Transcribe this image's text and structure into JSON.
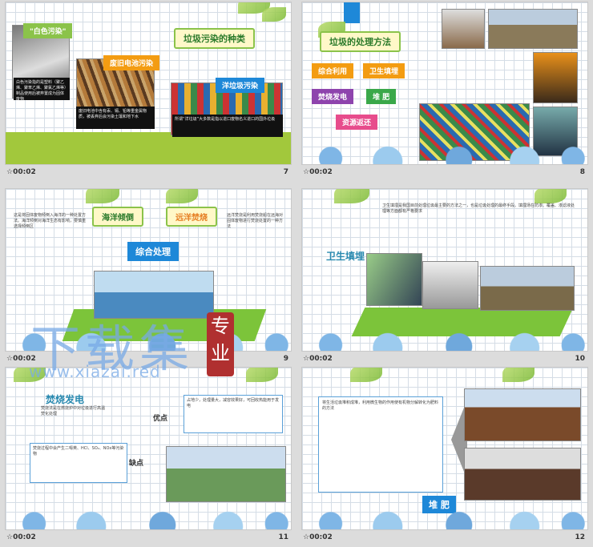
{
  "slides": [
    {
      "time": "00:02",
      "num": "7",
      "title": "垃圾污染的种类",
      "labels": {
        "white": "\"白色污染\"",
        "battery": "废旧电池污染",
        "ocean": "洋垃圾污染"
      },
      "texts": {
        "white": "白色污染指的是塑料（聚乙烯、聚苯乙烯、聚氯乙烯等）制品使用后被弃置成为固体废物",
        "battery": "废旧电池中含有汞、镉、铅等重金属物质，被丢弃后会污染土壤和地下水",
        "ocean": "所谓“洋垃圾”大多数是指以进口废物名义进口的国外垃圾"
      }
    },
    {
      "time": "00:02",
      "num": "8",
      "title": "垃圾的处理方法",
      "methods": [
        "综合利用",
        "卫生填埋",
        "焚烧发电",
        "堆 肥",
        "资源返还"
      ]
    },
    {
      "time": "00:02",
      "num": "9",
      "labels": {
        "ocean": "海洋倾倒",
        "far": "远洋焚烧",
        "center": "综合处理"
      },
      "left_text": "这是将固体废物倾倒入海洋的一种处置方法。海洋倾倒对海洋生态有影响，要慎重选择倾倒区",
      "right_text": "远洋焚烧是利用焚烧船在远海对固体废物进行焚烧处置的一种方法"
    },
    {
      "time": "00:02",
      "num": "10",
      "title": "卫生填埋",
      "text": "卫生填埋是我国目前处理垃圾最主要的方法之一，也是垃圾处理的最终手段。填埋场在防渗、覆盖、渗滤液处理等方面都有严格要求"
    },
    {
      "time": "00:02",
      "num": "11",
      "title": "焚烧发电",
      "sub": "焚烧法是在燃烧炉中对垃圾进行高温焚化处理",
      "pros_label": "优点",
      "cons_label": "缺点",
      "pros": "占地少，处理量大，减容效果好，可回收热能用于发电",
      "cons": "焚烧过程中会产生二噁英、HCl、SO₂、NOx等污染物"
    },
    {
      "time": "00:02",
      "num": "12",
      "title": "堆 肥",
      "text": "将生活垃圾堆积成堆，利用微生物的作用使有机物分解转化为肥料的方法"
    }
  ],
  "watermark": {
    "main": "下载集",
    "url": "www.xiazai.red",
    "seal": "专业"
  },
  "colors": {
    "green": "#8bc34a",
    "orange": "#f39c12",
    "purple": "#8e44ad",
    "blue": "#1e88d8"
  }
}
